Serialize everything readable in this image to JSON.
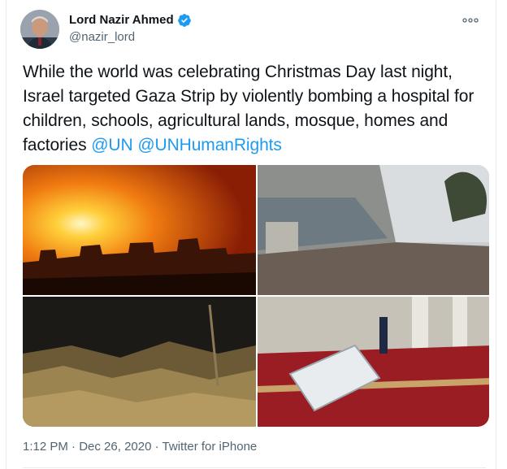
{
  "author": {
    "display_name": "Lord Nazir Ahmed",
    "handle": "@nazir_lord",
    "verified": true,
    "avatar_icon": "avatar-photo"
  },
  "menu": {
    "icon": "more-horizontal-icon"
  },
  "tweet": {
    "text": "While the world was celebrating Christmas Day last night, Israel targeted Gaza Strip by violently bombing a hospital for children, schools, agricultural lands, mosque, homes and factories ",
    "mentions": [
      "@UN",
      "@UNHumanRights"
    ]
  },
  "media": [
    {
      "icon": "explosion-night-photo"
    },
    {
      "icon": "damaged-street-photo"
    },
    {
      "icon": "rubble-night-photo"
    },
    {
      "icon": "damaged-mosque-interior-photo"
    }
  ],
  "meta": {
    "time": "1:12 PM",
    "separator": "·",
    "date": "Dec 26, 2020",
    "source": "Twitter for iPhone"
  },
  "colors": {
    "accent": "#1d9bf0",
    "text": "#0f1419",
    "muted": "#536471"
  }
}
